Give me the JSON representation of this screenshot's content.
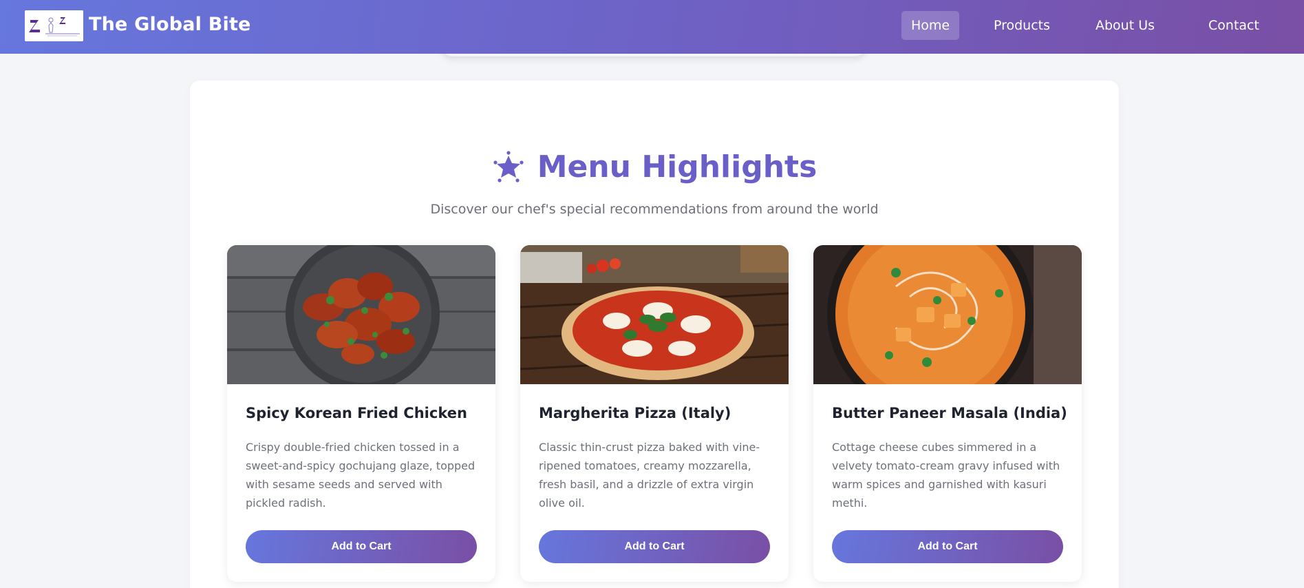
{
  "brand": {
    "name": "The Global Bite",
    "logo_icon": "brand-logo-icon"
  },
  "nav": {
    "items": [
      {
        "label": "Home",
        "active": true
      },
      {
        "label": "Products",
        "active": false
      },
      {
        "label": "About Us",
        "active": false
      },
      {
        "label": "Contact",
        "active": false
      }
    ]
  },
  "section": {
    "icon": "sparkle-star-icon",
    "title": "Menu Highlights",
    "subtitle": "Discover our chef's special recommendations from around the world"
  },
  "cards": [
    {
      "title": "Spicy Korean Fried Chicken",
      "description": "Crispy double-fried chicken tossed in a sweet-and-spicy gochujang glaze, topped with sesame seeds and served with pickled radish.",
      "button": "Add to Cart"
    },
    {
      "title": "Margherita Pizza (Italy)",
      "description": "Classic thin-crust pizza baked with vine-ripened tomatoes, creamy mozzarella, fresh basil, and a drizzle of extra virgin olive oil.",
      "button": "Add to Cart"
    },
    {
      "title": "Butter Paneer Masala (India)",
      "description": "Cottage cheese cubes simmered in a velvety tomato-cream gravy infused with warm spices and garnished with kasuri methi.",
      "button": "Add to Cart"
    }
  ],
  "colors": {
    "accent": "#6a5fc9",
    "header_start": "#6677dd",
    "header_end": "#7a4fa5",
    "page_bg": "#f3f5f9"
  }
}
